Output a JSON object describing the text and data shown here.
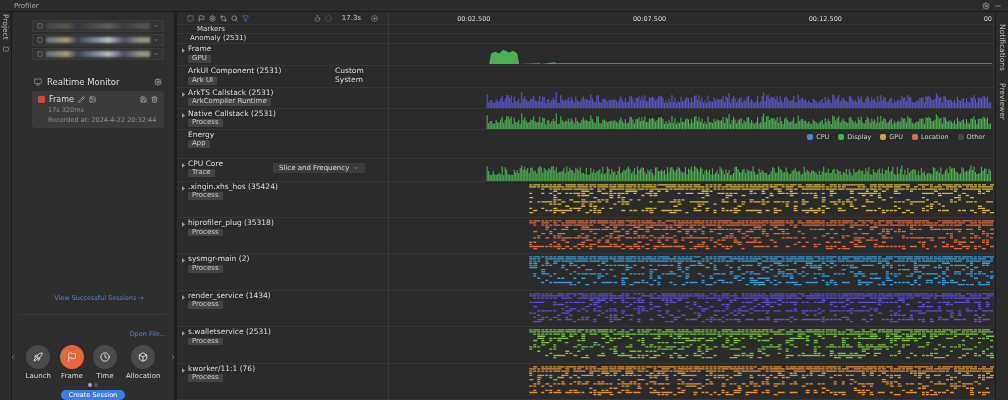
{
  "window": {
    "title": "Profiler"
  },
  "side_strip": {
    "tab": "Project"
  },
  "right_strip": [
    "Notifications",
    "Previewer"
  ],
  "monitor": {
    "title": "Realtime Monitor"
  },
  "session": {
    "name": "Frame",
    "duration": "17s 320ms",
    "recorded": "Recorded at: 2024-4-22 20:32:44"
  },
  "view_sessions_link": "View Successful Sessions →",
  "open_file": "Open File...",
  "templates": [
    {
      "label": "Launch",
      "selected": false
    },
    {
      "label": "Frame",
      "selected": true
    },
    {
      "label": "Time",
      "selected": false
    },
    {
      "label": "Allocation",
      "selected": false
    }
  ],
  "pager": [
    {
      "selected": true
    },
    {
      "selected": false
    }
  ],
  "create_button": "Create Session",
  "toolbar": {
    "duration": "17.3s"
  },
  "timeline": {
    "ticks": [
      "00:02.500",
      "00:07.500",
      "00:12.500",
      "00"
    ]
  },
  "tracks": [
    {
      "kind": "label",
      "name": "Markers",
      "expandable": false
    },
    {
      "kind": "label",
      "name": "Anomaly (2531)",
      "expandable": false
    },
    {
      "kind": "area",
      "name": "Frame",
      "tag": "GPU",
      "expandable": true,
      "color": "#4caf50"
    },
    {
      "kind": "plain",
      "name": "ArkUI Component (2531)",
      "tag": "Ark UI",
      "expandable": false,
      "side": [
        "Custom",
        "System"
      ]
    },
    {
      "kind": "wave",
      "name": "ArkTS Callstack (2531)",
      "tag": "ArkCompiler Runtime",
      "expandable": true,
      "color": "#5b55c9"
    },
    {
      "kind": "wave",
      "name": "Native Callstack (2531)",
      "tag": "Process",
      "expandable": true,
      "color": "#4caf50"
    },
    {
      "kind": "energy",
      "name": "Energy",
      "tag": "App",
      "expandable": false,
      "legend": [
        {
          "label": "CPU",
          "color": "#3d8fd1"
        },
        {
          "label": "Display",
          "color": "#4caf50"
        },
        {
          "label": "GPU",
          "color": "#c9a93a"
        },
        {
          "label": "Location",
          "color": "#d96b4f"
        },
        {
          "label": "Other",
          "color": "#4a4a4a"
        }
      ]
    },
    {
      "kind": "wave",
      "name": "CPU Core",
      "tag": "Trace",
      "expandable": true,
      "color": "#4caf50",
      "dropdown": "Slice and Frequency"
    },
    {
      "kind": "process",
      "name": ".xingin.xhs_hos (35424)",
      "tag": "Process",
      "expandable": true,
      "color": "#d6b43c"
    },
    {
      "kind": "process",
      "name": "hiprofiler_plug (35318)",
      "tag": "Process",
      "expandable": true,
      "color": "#d9683f"
    },
    {
      "kind": "process",
      "name": "sysmgr-main (2)",
      "tag": "Process",
      "expandable": true,
      "color": "#3b9ad6"
    },
    {
      "kind": "process",
      "name": "render_service (1434)",
      "tag": "Process",
      "expandable": true,
      "color": "#5f4fd8"
    },
    {
      "kind": "process",
      "name": "s.walletservice (2531)",
      "tag": "Process",
      "expandable": true,
      "color": "#7cbf3f"
    },
    {
      "kind": "process",
      "name": "kworker/11:1 (76)",
      "tag": "Process",
      "expandable": true,
      "color": "#e0913a"
    }
  ]
}
